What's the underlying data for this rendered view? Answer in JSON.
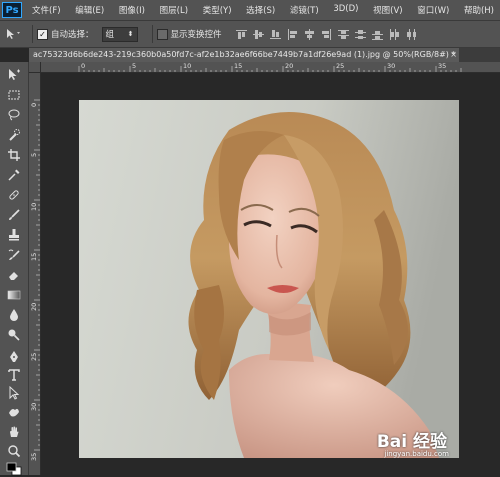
{
  "app": {
    "logo": "Ps",
    "brand_color": "#31a8ff"
  },
  "menu": [
    "文件(F)",
    "编辑(E)",
    "图像(I)",
    "图层(L)",
    "类型(Y)",
    "选择(S)",
    "滤镜(T)",
    "3D(D)",
    "视图(V)",
    "窗口(W)",
    "帮助(H)"
  ],
  "options": {
    "auto_select_label": "自动选择：",
    "auto_select_checked": true,
    "auto_select_value": "组",
    "show_transform_label": "显示变换控件",
    "show_transform_checked": false
  },
  "document": {
    "tab_title": "ac75323d6b6de243-219c360b0a50fd7c-af2e1b32ae6f66be7449b7a1df26e9ad (1).jpg @ 50%(RGB/8#) *",
    "close_label": "×"
  },
  "ruler": {
    "top_labels": [
      "0",
      "5",
      "10",
      "15",
      "20",
      "25",
      "30",
      "35"
    ],
    "left_labels": [
      "0",
      "5",
      "10",
      "15",
      "20",
      "25",
      "30",
      "35"
    ]
  },
  "tools": [
    "move-tool",
    "marquee-tool",
    "lasso-tool",
    "quick-select-tool",
    "crop-tool",
    "eyedropper-tool",
    "healing-brush-tool",
    "brush-tool",
    "clone-stamp-tool",
    "history-brush-tool",
    "eraser-tool",
    "gradient-tool",
    "blur-tool",
    "dodge-tool",
    "pen-tool",
    "type-tool",
    "path-select-tool",
    "shape-tool",
    "hand-tool",
    "zoom-tool"
  ],
  "watermark": {
    "main": "Bai 经验",
    "sub": "jingyan.baidu.com"
  }
}
